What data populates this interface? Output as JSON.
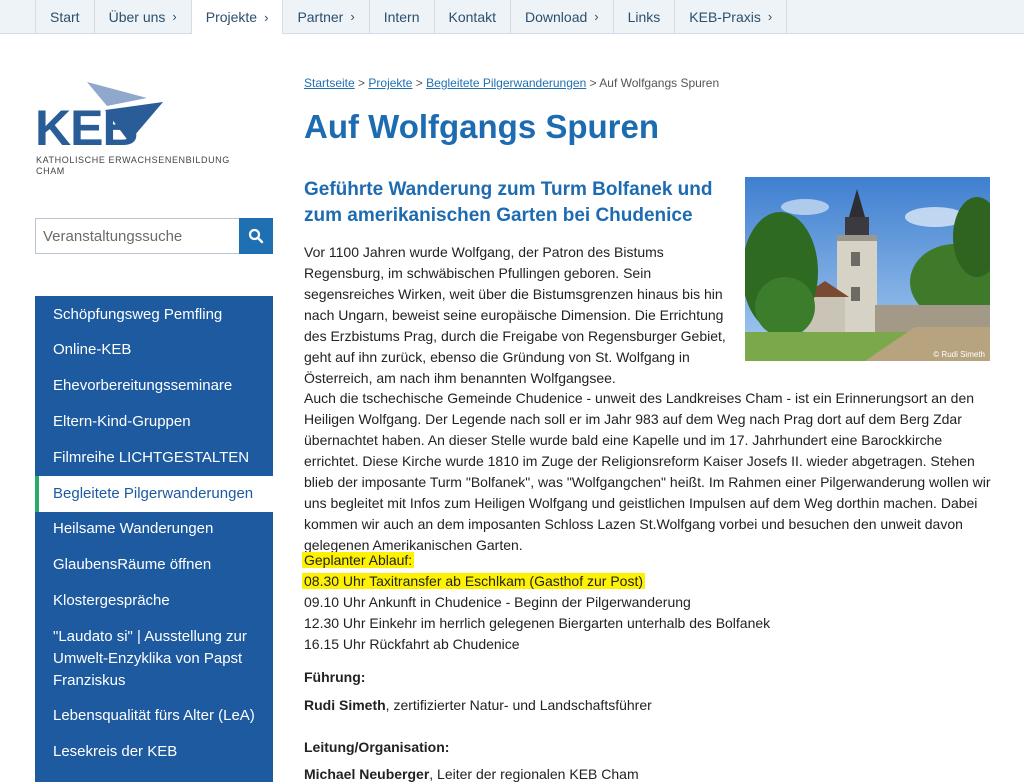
{
  "nav": {
    "items": [
      {
        "label": "Start",
        "chevron": false
      },
      {
        "label": "Über uns",
        "chevron": true
      },
      {
        "label": "Projekte",
        "chevron": true,
        "active": true
      },
      {
        "label": "Partner",
        "chevron": true
      },
      {
        "label": "Intern",
        "chevron": false
      },
      {
        "label": "Kontakt",
        "chevron": false
      },
      {
        "label": "Download",
        "chevron": true
      },
      {
        "label": "Links",
        "chevron": false
      },
      {
        "label": "KEB-Praxis",
        "chevron": true
      }
    ]
  },
  "logo": {
    "text": "KEB",
    "subtitle_line1": "KATHOLISCHE ERWACHSENENBILDUNG",
    "subtitle_line2": "CHAM"
  },
  "search": {
    "placeholder": "Veranstaltungssuche"
  },
  "sidebar": {
    "items": [
      {
        "label": "Schöpfungsweg Pemfling"
      },
      {
        "label": "Online-KEB"
      },
      {
        "label": "Ehevorbereitungsseminare"
      },
      {
        "label": "Eltern-Kind-Gruppen"
      },
      {
        "label": "Filmreihe LICHTGESTALTEN"
      },
      {
        "label": "Begleitete Pilgerwanderungen",
        "active": true
      },
      {
        "label": "Heilsame Wanderungen"
      },
      {
        "label": "GlaubensRäume öffnen"
      },
      {
        "label": "Klostergespräche"
      },
      {
        "label": "\"Laudato si\" | Ausstellung zur Umwelt-Enzyklika von Papst Franziskus"
      },
      {
        "label": "Lebensqualität fürs Alter (LeA)"
      },
      {
        "label": "Lesekreis der KEB"
      }
    ]
  },
  "breadcrumb": {
    "items": [
      "Startseite",
      "Projekte",
      "Begleitete Pilgerwanderungen"
    ],
    "separator": ">",
    "current": "Auf Wolfgangs Spuren"
  },
  "page": {
    "title": "Auf Wolfgangs Spuren",
    "subtitle": "Geführte Wanderung zum Turm Bolfanek und zum amerikanischen Garten bei Chudenice",
    "photo_credit": "© Rudi Simeth",
    "paragraph1": "Vor 1100 Jahren wurde Wolfgang, der Patron des Bistums Regensburg, im schwäbischen Pfullingen geboren. Sein segensreiches Wirken, weit über die Bistumsgrenzen hinaus bis hin nach Ungarn, beweist seine europäische Dimension. Die Errichtung des Erzbistums Prag, durch die Freigabe von Regensburger Gebiet, geht auf ihn zurück, ebenso die Gründung von St. Wolfgang in Österreich, am nach ihm benannten Wolfgangsee.",
    "paragraph2": "Auch die tschechische Gemeinde Chudenice - unweit des Landkreises Cham - ist ein Erinnerungsort an den Heiligen Wolfgang. Der Legende nach soll er im Jahr 983 auf dem Weg nach Prag dort auf dem Berg Zdar übernachtet haben. An dieser Stelle wurde bald eine Kapelle und im 17. Jahrhundert eine Barockkirche errichtet. Diese Kirche wurde 1810 im Zuge der Religionsreform Kaiser Josefs II. wieder abgetragen. Stehen blieb der imposante Turm \"Bolfanek\", was \"Wolfgangchen\" heißt. Im Rahmen einer Pilgerwanderung wollen wir uns begleitet mit Infos zum Heiligen Wolfgang und geistlichen Impulsen auf dem Weg dorthin machen. Dabei kommen wir auch an dem imposanten Schloss Lazen St.Wolfgang vorbei und besuchen den unweit davon gelegenen Amerikanischen Garten.",
    "schedule_heading": "Geplanter Ablauf:",
    "schedule": [
      "08.30 Uhr Taxitransfer ab Eschlkam (Gasthof zur Post)",
      "09.10 Uhr Ankunft in Chudenice - Beginn der Pilgerwanderung",
      "12.30 Uhr Einkehr im herrlich gelegenen Biergarten unterhalb des Bolfanek",
      "16.15 Uhr Rückfahrt ab Chudenice"
    ],
    "guide_label": "Führung:",
    "guide_name": "Rudi Simeth",
    "guide_desc": ", zertifizierter Natur- und Landschaftsführer",
    "org_label": "Leitung/Organisation:",
    "org_name": "Michael Neuberger",
    "org_desc": ", Leiter der regionalen KEB Cham"
  },
  "colors": {
    "brand_blue": "#1d5aa0",
    "heading_blue": "#1d6bb0",
    "highlight": "#fff200",
    "active_marker": "#2aa96b"
  }
}
